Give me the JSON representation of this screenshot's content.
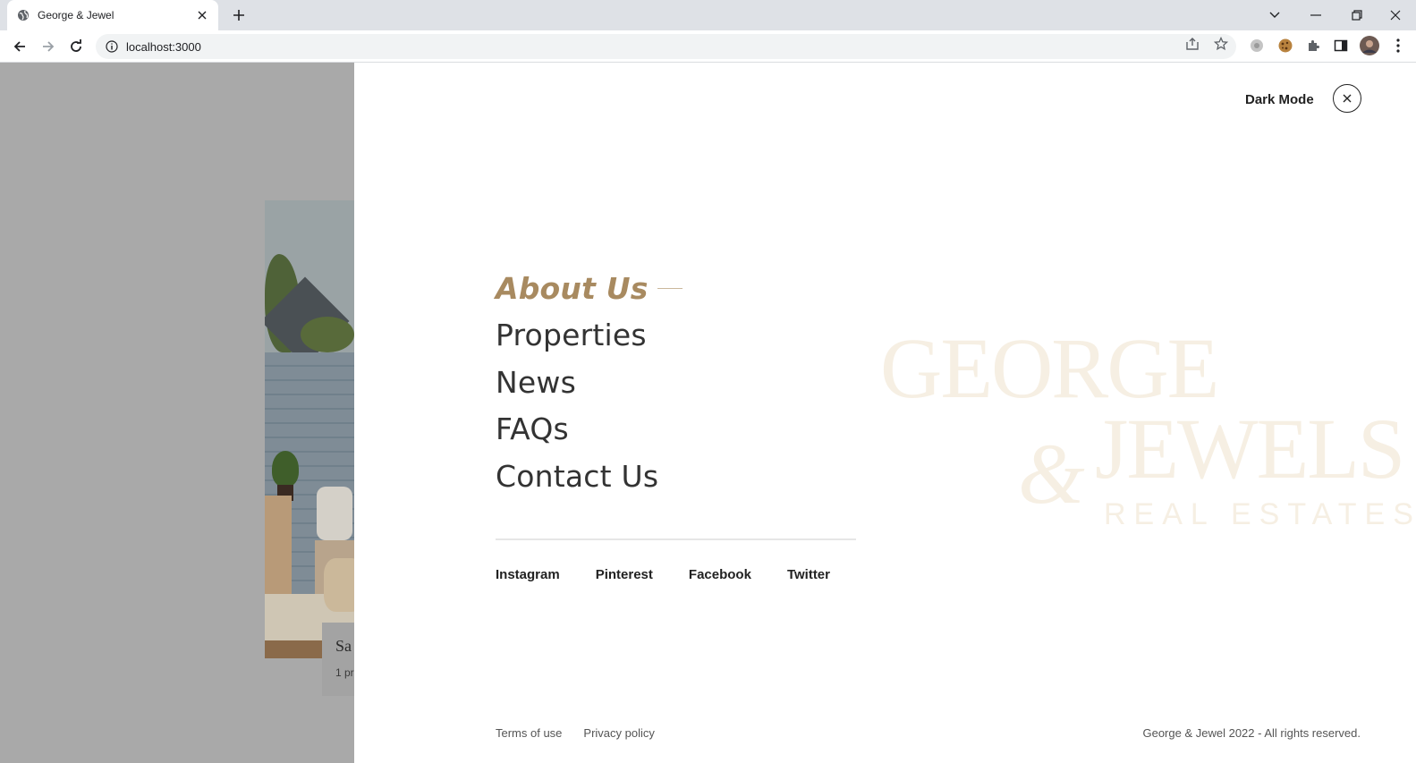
{
  "browser": {
    "tab_title": "George & Jewel",
    "url": "localhost:3000"
  },
  "backdrop": {
    "card_title": "Sa",
    "card_subtitle": "1 pr"
  },
  "menu": {
    "dark_mode_label": "Dark Mode",
    "nav_items": [
      {
        "label": "About Us",
        "active": true
      },
      {
        "label": "Properties",
        "active": false
      },
      {
        "label": "News",
        "active": false
      },
      {
        "label": "FAQs",
        "active": false
      },
      {
        "label": "Contact Us",
        "active": false
      }
    ],
    "social_links": [
      "Instagram",
      "Pinterest",
      "Facebook",
      "Twitter"
    ],
    "footer_links": [
      "Terms of use",
      "Privacy policy"
    ],
    "copyright": "George & Jewel 2022 - All rights reserved.",
    "watermark": {
      "line1": "GEORGE",
      "ampersand": "&",
      "line2": "JEWELS",
      "line3": "REAL ESTATES"
    }
  },
  "colors": {
    "accent": "#a88a60",
    "watermark": "#f6efe3",
    "overlay": "#a9a9a9"
  }
}
